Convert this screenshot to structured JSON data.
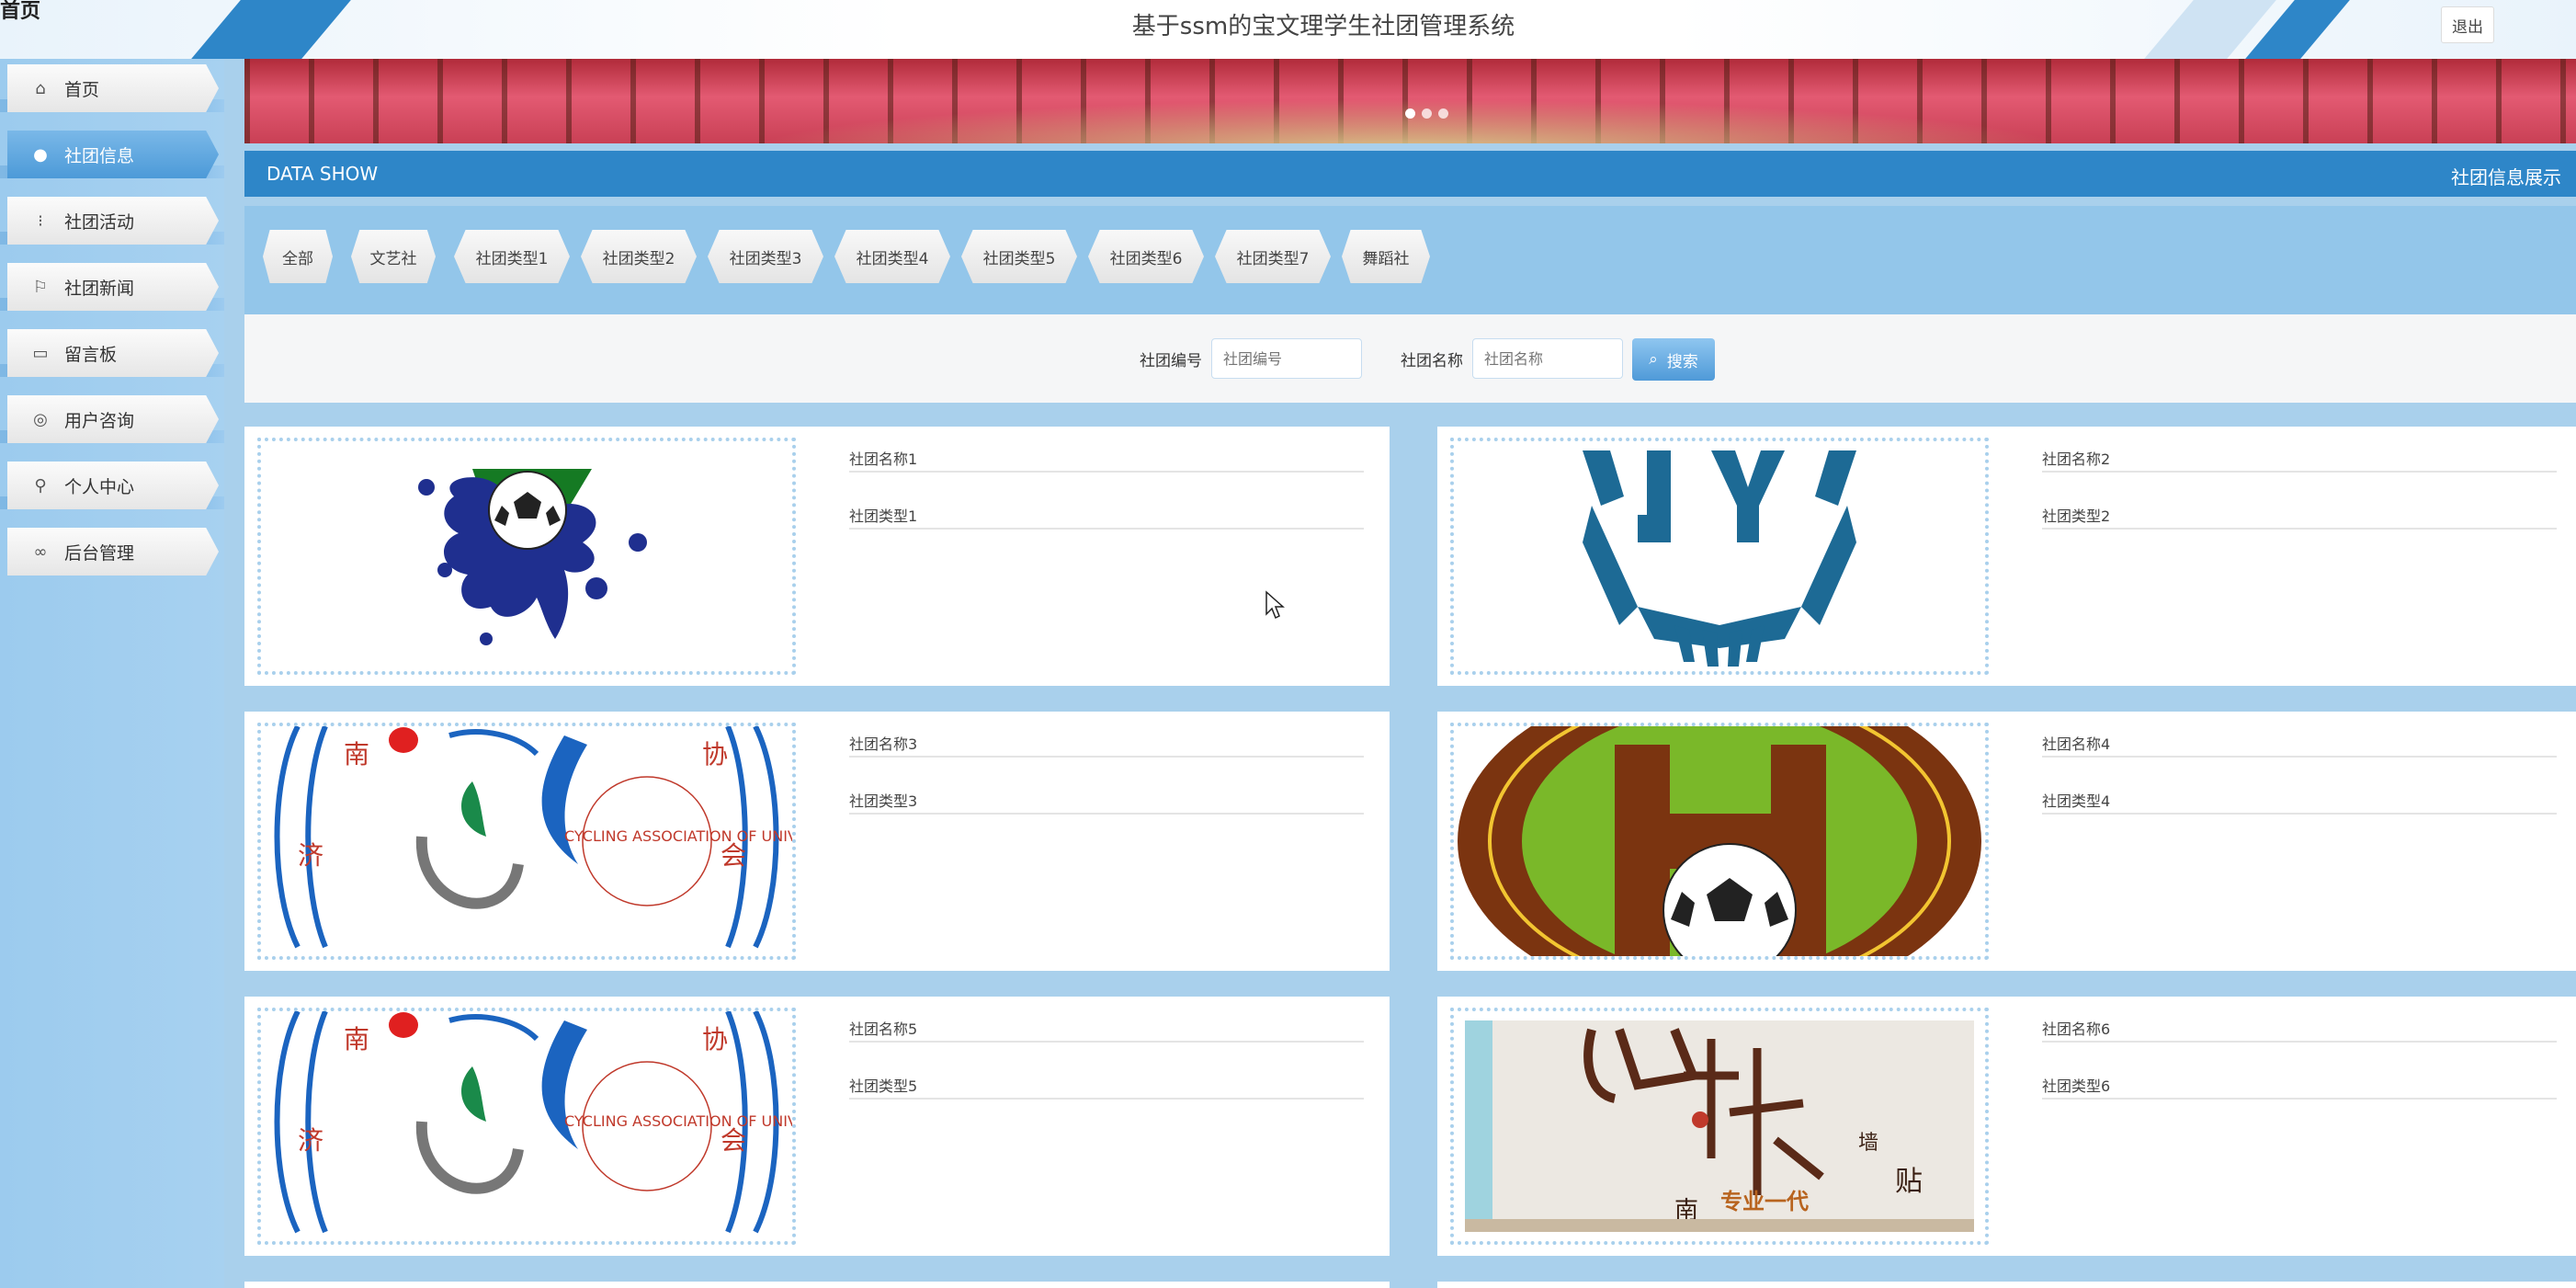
{
  "header": {
    "left_label": "首页",
    "title": "基于ssm的宝文理学生社团管理系统",
    "logout_label": "退出"
  },
  "sidebar": {
    "items": [
      {
        "label": "首页",
        "icon": "home-icon",
        "active": false
      },
      {
        "label": "社团信息",
        "icon": "circle-icon",
        "active": true
      },
      {
        "label": "社团活动",
        "icon": "sliders-icon",
        "active": false
      },
      {
        "label": "社团新闻",
        "icon": "flag-icon",
        "active": false
      },
      {
        "label": "留言板",
        "icon": "note-icon",
        "active": false
      },
      {
        "label": "用户咨询",
        "icon": "chat-icon",
        "active": false
      },
      {
        "label": "个人中心",
        "icon": "user-icon",
        "active": false
      },
      {
        "label": "后台管理",
        "icon": "link-icon",
        "active": false
      }
    ]
  },
  "banner": {
    "dots": 3,
    "active_dot": 0
  },
  "section": {
    "title_en": "DATA SHOW",
    "title_cn": "社团信息展示"
  },
  "categories": [
    "全部",
    "文艺社",
    "社团类型1",
    "社团类型2",
    "社团类型3",
    "社团类型4",
    "社团类型5",
    "社团类型6",
    "社团类型7",
    "舞蹈社"
  ],
  "search": {
    "field1_label": "社团编号",
    "field1_placeholder": "社团编号",
    "field2_label": "社团名称",
    "field2_placeholder": "社团名称",
    "button_label": "搜索"
  },
  "clubs": [
    {
      "name": "社团名称1",
      "type": "社团类型1",
      "logo": "paint-splash-soccer-logo"
    },
    {
      "name": "社团名称2",
      "type": "社团类型2",
      "logo": "jy-wings-logo"
    },
    {
      "name": "社团名称3",
      "type": "社团类型3",
      "logo": "cycling-association-logo",
      "logo_text": "CYCLING ASSOCIATION OF UNIVERSITY OF JINAN"
    },
    {
      "name": "社团名称4",
      "type": "社团类型4",
      "logo": "green-football-badge-logo"
    },
    {
      "name": "社团名称5",
      "type": "社团类型5",
      "logo": "cycling-association-logo",
      "logo_text": "CYCLING ASSOCIATION OF UNIVERSITY OF JINAN"
    },
    {
      "name": "社团名称6",
      "type": "社团类型6",
      "logo": "chess-calligraphy-poster",
      "logo_text": "专业一代"
    }
  ],
  "colors": {
    "primary": "#2e86c8",
    "sidebar_bg": "#a7d1f0",
    "category_bar": "#93c6ea",
    "page_bg": "#a9d0ec"
  }
}
